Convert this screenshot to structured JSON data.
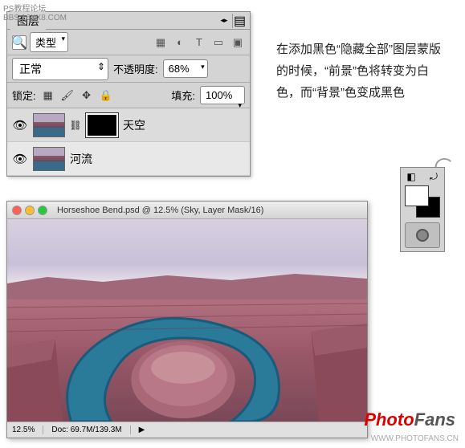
{
  "watermarks": {
    "topLeft1": "PS教程论坛",
    "topLeft2": "BBS.16XX8.COM",
    "bottomRight": "WWW.PHOTOFANS.CN",
    "brand1": "Photo",
    "brand2": "Fans"
  },
  "layersPanel": {
    "tabTitle": "图层",
    "filterLabel": "类型",
    "blendMode": "正常",
    "opacityLabel": "不透明度:",
    "opacityValue": "68%",
    "lockLabel": "锁定:",
    "fillLabel": "填充:",
    "fillValue": "100%",
    "layers": [
      {
        "name": "天空",
        "hasMask": true
      },
      {
        "name": "河流",
        "hasMask": false
      }
    ]
  },
  "docWindow": {
    "title": "Horseshoe Bend.psd @ 12.5% (Sky, Layer Mask/16)",
    "zoom": "12.5%",
    "docSize": "Doc: 69.7M/139.3M"
  },
  "sideText": "在添加黑色“隐藏全部”图层蒙版的时候，“前景”色将转变为白色，而“背景”色变成黑色"
}
